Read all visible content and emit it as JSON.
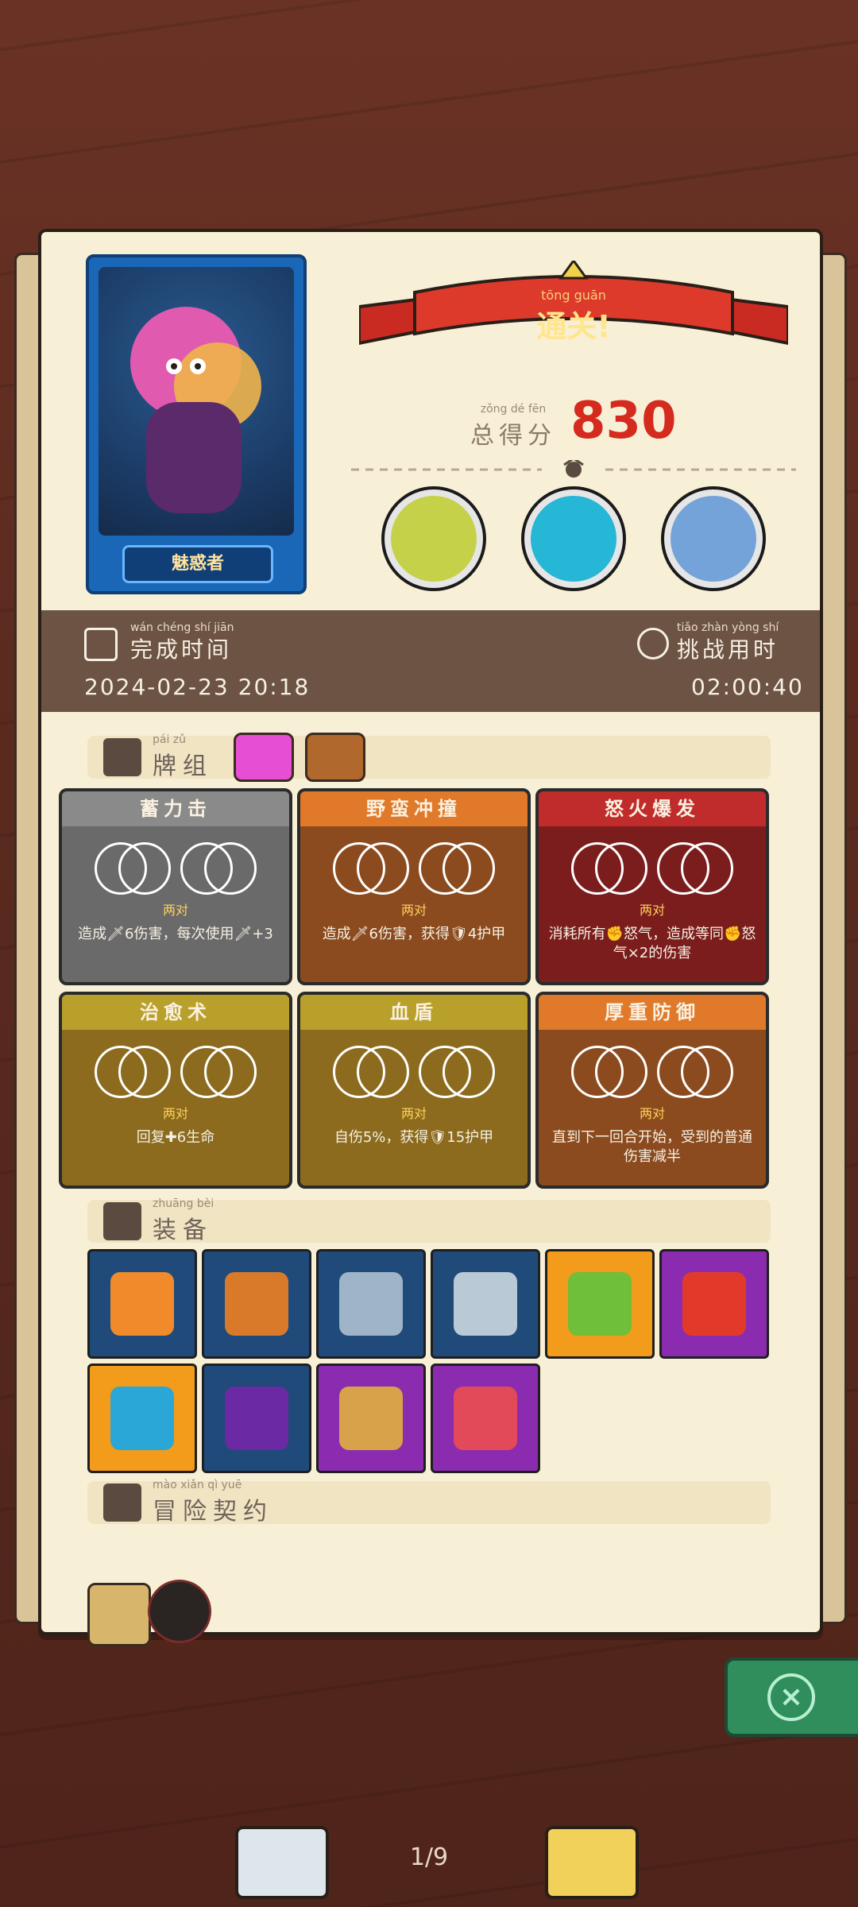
{
  "app": {
    "theme_colors": {
      "accent_red": "#d52a1e",
      "panel_brown": "#6c5344",
      "tile_blue": "#1f4a7a",
      "tile_orange": "#f39b1a",
      "tile_purple": "#8b2bb0",
      "success_green": "#2f8e5b"
    }
  },
  "header": {
    "ribbon_title": "通关!",
    "ribbon_ruby": "tōng guān",
    "score_label": "总得分",
    "score_ruby": "zǒng dé fēn",
    "score_value": "830"
  },
  "character": {
    "name": "魅惑者"
  },
  "bosses": [
    {
      "name": "boss-1",
      "icon": "green-dragon-skull"
    },
    {
      "name": "boss-2",
      "icon": "black-horse"
    },
    {
      "name": "boss-3",
      "icon": "blue-boar"
    }
  ],
  "stats": {
    "completion_time_label": "完成时间",
    "completion_time_ruby": "wán chéng shí jiān",
    "completion_time_value": "2024-02-23 20:18",
    "challenge_time_label": "挑战用时",
    "challenge_time_ruby": "tiǎo zhàn yòng shí",
    "challenge_time_value": "02:00:40"
  },
  "sections": {
    "combos_title": "牌组",
    "combos_ruby": "pái zǔ",
    "equipment_title": "装备",
    "equipment_ruby": "zhuāng bèi",
    "pact_title": "冒险契约",
    "pact_ruby": "mào xiǎn qì yuē"
  },
  "combos": [
    {
      "title": "蓄力击",
      "sub": "两对",
      "desc": "造成🗡6伤害，每次使用🗡+3",
      "color": "#6a6a6a",
      "header": "#8a8a8a"
    },
    {
      "title": "野蛮冲撞",
      "sub": "两对",
      "desc": "造成🗡6伤害，获得🛡4护甲",
      "color": "#8b4b1f",
      "header": "#e07a2a"
    },
    {
      "title": "怒火爆发",
      "sub": "两对",
      "desc": "消耗所有✊怒气，造成等同✊怒气×2的伤害",
      "color": "#7b1d1d",
      "header": "#c02b2b"
    },
    {
      "title": "治愈术",
      "sub": "两对",
      "desc": "回复✚6生命",
      "color": "#8c6b1f",
      "header": "#b9a02a"
    },
    {
      "title": "血盾",
      "sub": "两对",
      "desc": "自伤5%，获得🛡15护甲",
      "color": "#8c6b1f",
      "header": "#b9a02a"
    },
    {
      "title": "厚重防御",
      "sub": "两对",
      "desc": "直到下一回合开始，受到的普通伤害减半",
      "color": "#8b4b1f",
      "header": "#e07a2a"
    }
  ],
  "equipment": [
    {
      "name": "lightning-orb",
      "bg": "#1f4a7a"
    },
    {
      "name": "golden-fruit-pot",
      "bg": "#1f4a7a"
    },
    {
      "name": "armor-chestplate",
      "bg": "#1f4a7a"
    },
    {
      "name": "stone-axe",
      "bg": "#1f4a7a"
    },
    {
      "name": "green-scroll",
      "bg": "#f39b1a"
    },
    {
      "name": "red-sword-gem",
      "bg": "#8b2bb0"
    },
    {
      "name": "blue-shield-emblem",
      "bg": "#f39b1a"
    },
    {
      "name": "skull-spellbook",
      "bg": "#1f4a7a"
    },
    {
      "name": "crystal-ring",
      "bg": "#8b2bb0"
    },
    {
      "name": "red-slime-jar",
      "bg": "#8b2bb0"
    }
  ],
  "pact": {
    "items": [
      {
        "name": "contract-scroll"
      },
      {
        "name": "potion-bottle"
      }
    ]
  },
  "nav": {
    "page_indicator": "1/9"
  }
}
